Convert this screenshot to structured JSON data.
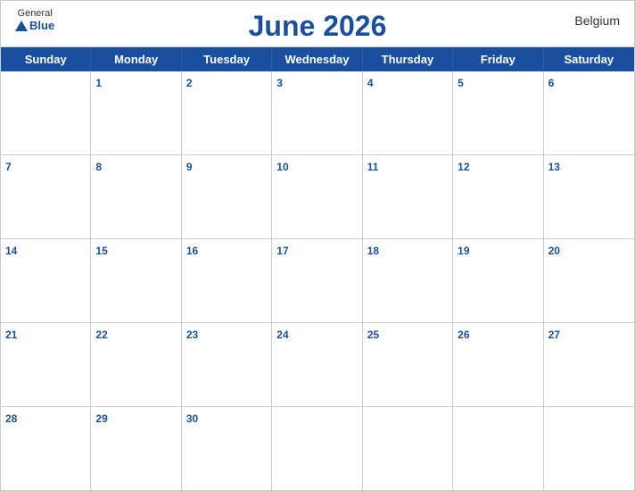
{
  "header": {
    "logo": {
      "general": "General",
      "blue": "Blue"
    },
    "title": "June 2026",
    "country": "Belgium"
  },
  "dayHeaders": [
    "Sunday",
    "Monday",
    "Tuesday",
    "Wednesday",
    "Thursday",
    "Friday",
    "Saturday"
  ],
  "weeks": [
    [
      {
        "day": "",
        "empty": true
      },
      {
        "day": "1"
      },
      {
        "day": "2"
      },
      {
        "day": "3"
      },
      {
        "day": "4"
      },
      {
        "day": "5"
      },
      {
        "day": "6"
      }
    ],
    [
      {
        "day": "7"
      },
      {
        "day": "8"
      },
      {
        "day": "9"
      },
      {
        "day": "10"
      },
      {
        "day": "11"
      },
      {
        "day": "12"
      },
      {
        "day": "13"
      }
    ],
    [
      {
        "day": "14"
      },
      {
        "day": "15"
      },
      {
        "day": "16"
      },
      {
        "day": "17"
      },
      {
        "day": "18"
      },
      {
        "day": "19"
      },
      {
        "day": "20"
      }
    ],
    [
      {
        "day": "21"
      },
      {
        "day": "22"
      },
      {
        "day": "23"
      },
      {
        "day": "24"
      },
      {
        "day": "25"
      },
      {
        "day": "26"
      },
      {
        "day": "27"
      }
    ],
    [
      {
        "day": "28"
      },
      {
        "day": "29"
      },
      {
        "day": "30"
      },
      {
        "day": "",
        "empty": true
      },
      {
        "day": "",
        "empty": true
      },
      {
        "day": "",
        "empty": true
      },
      {
        "day": "",
        "empty": true
      }
    ]
  ],
  "colors": {
    "headerBg": "#1a4fa0",
    "headerText": "#ffffff",
    "dayNumber": "#1a4fa0",
    "border": "#cccccc"
  }
}
